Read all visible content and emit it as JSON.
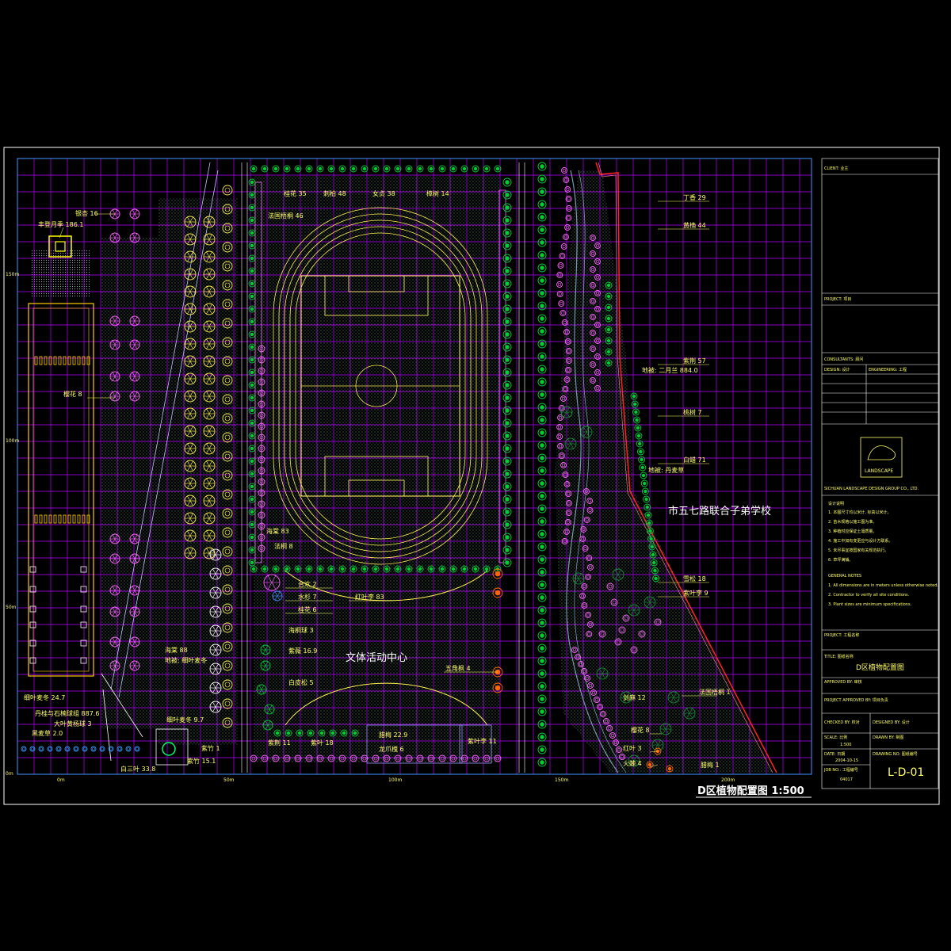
{
  "drawing": {
    "title": "D区植物配置图 1:500",
    "sheet_number": "L-D-01",
    "school_label": "市五七路联合子弟学校",
    "center_label": "文体活动中心",
    "axis_ticks_x": [
      "0m",
      "50m",
      "100m",
      "150m",
      "200m"
    ],
    "axis_ticks_y": [
      "150m",
      "100m",
      "50m",
      "0m"
    ]
  },
  "plant_labels": [
    {
      "text": "银杏 16"
    },
    {
      "text": "丰登月季 186.1"
    },
    {
      "text": "樱花 8"
    },
    {
      "text": "桂花 35"
    },
    {
      "text": "刺柏 48"
    },
    {
      "text": "女贞 38"
    },
    {
      "text": "樟树 14"
    },
    {
      "text": "法国梧桐 46"
    },
    {
      "text": "丁香 29"
    },
    {
      "text": "黄桷 44"
    },
    {
      "text": "紫荆 57"
    },
    {
      "text": "地被: 二月兰 884.0"
    },
    {
      "text": "桃树 7"
    },
    {
      "text": "白蜡 71"
    },
    {
      "text": "地被: 丹麦草"
    },
    {
      "text": "雪松 18"
    },
    {
      "text": "紫叶李 9"
    },
    {
      "text": "海棠 83"
    },
    {
      "text": "法桐 8"
    },
    {
      "text": "合欢 2"
    },
    {
      "text": "水杉 7"
    },
    {
      "text": "桂花 6"
    },
    {
      "text": "红叶李 83"
    },
    {
      "text": "海桐球 3"
    },
    {
      "text": "紫薇 16.9"
    },
    {
      "text": "五角枫 4"
    },
    {
      "text": "白皮松 5"
    },
    {
      "text": "剑麻 12"
    },
    {
      "text": "法国梧桐 1"
    },
    {
      "text": "樱花 8"
    },
    {
      "text": "红叶 3"
    },
    {
      "text": "火棘 4"
    },
    {
      "text": "腊梅 1"
    },
    {
      "text": "海棠 88"
    },
    {
      "text": "地被: 细叶麦冬"
    },
    {
      "text": "细叶麦冬 24.7"
    },
    {
      "text": "丹桂与石楠球组 887.6"
    },
    {
      "text": "大叶黄杨球 3"
    },
    {
      "text": "黑麦草 2.0"
    },
    {
      "text": "细叶麦冬 9.7"
    },
    {
      "text": "紫竹 1"
    },
    {
      "text": "紫竹 15.1"
    },
    {
      "text": "白三叶 33.8"
    },
    {
      "text": "紫荆 11"
    },
    {
      "text": "紫叶 18"
    },
    {
      "text": "腊梅 22.9"
    },
    {
      "text": "龙爪槐 6"
    },
    {
      "text": "紫叶李 11"
    }
  ],
  "title_block": {
    "rows": [
      {
        "text": "CLIENT: 业主"
      },
      {
        "text": "PROJECT: 项目"
      },
      {
        "text": "CONSULTANTS: 顾问"
      },
      {
        "text": "DESIGN: 设计"
      },
      {
        "text": "ENGINEERING: 工程"
      },
      {
        "text": "PROJECT: 工程名称"
      },
      {
        "text": "TITLE: 图纸名称"
      },
      {
        "text": "D区植物配置图"
      },
      {
        "text": "APPROVED BY: 审核"
      },
      {
        "text": "PROJECT APPROVED BY: 项目负责"
      },
      {
        "text": "CHECKED BY: 校对"
      },
      {
        "text": "DESIGNED BY: 设计"
      },
      {
        "text": "SCALE: 比例"
      },
      {
        "text": "1:500"
      },
      {
        "text": "DRAWN BY: 制图"
      },
      {
        "text": "DATE: 日期"
      },
      {
        "text": "2004-10-15"
      },
      {
        "text": "DRAWING NO: 图纸编号"
      },
      {
        "text": "JOB NO.: 工程编号"
      },
      {
        "text": "04017"
      }
    ],
    "logo_text": "LANDSCAPE",
    "company_line": "SICHUAN LANDSCAPE DESIGN GROUP CO., LTD.",
    "notes_heading": "设计说明",
    "notes": [
      "1. 本图尺寸均以米计, 标高以米计。",
      "2. 苗木规格以施工图为准。",
      "3. 种植时应保证土壤质量。",
      "4. 施工中如有变更应与设计方联系。",
      "5. 未尽事宜按国家有关规范执行。",
      "6. 草坪满铺。"
    ],
    "notes_en_heading": "GENERAL NOTES",
    "notes_en": [
      "1. All dimensions are in meters unless otherwise noted.",
      "2. Contractor to verify all site conditions.",
      "3. Plant sizes are minimum specifications."
    ]
  },
  "colors": {
    "background": "#000000",
    "grid": "#b400ff",
    "frame": "#ffffff",
    "text": "#ffff66",
    "tree_green": "#00cc33",
    "tree_yellow": "#ffee55",
    "tree_pink": "#ff66ff",
    "border_red": "#ff2222",
    "track": "#ffee55",
    "orange": "#ff6600"
  }
}
